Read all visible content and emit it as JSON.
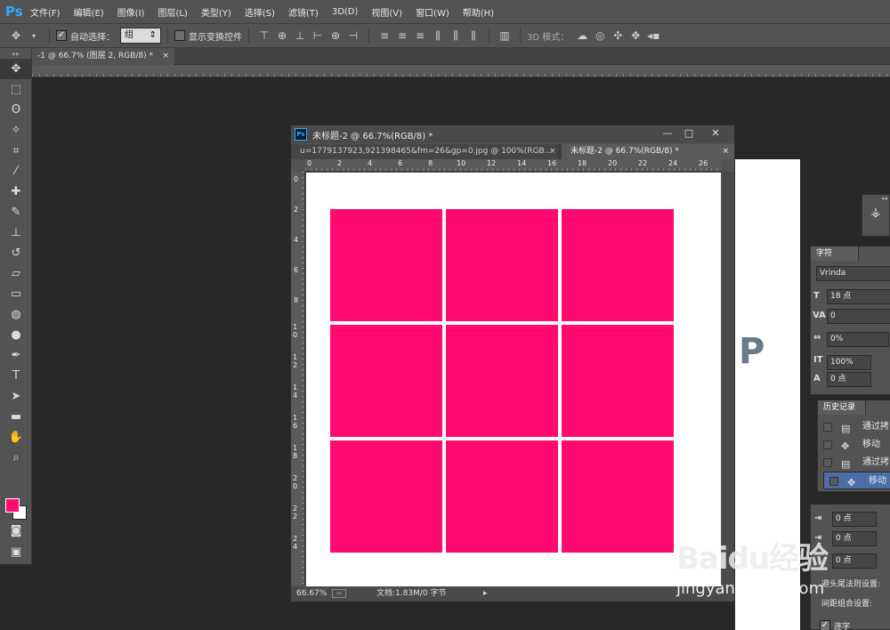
{
  "app": {
    "logo": "Ps"
  },
  "menu": [
    "文件(F)",
    "编辑(E)",
    "图像(I)",
    "图层(L)",
    "类型(Y)",
    "选择(S)",
    "滤镜(T)",
    "3D(D)",
    "视图(V)",
    "窗口(W)",
    "帮助(H)"
  ],
  "options": {
    "auto_select_label": "自动选择：",
    "auto_select_value": "组",
    "show_transform_label": "显示变换控件",
    "mode_3d_label": "3D 模式："
  },
  "main_tab": {
    "title": "-1 @ 66.7% (图层 2, RGB/8) *",
    "close": "×"
  },
  "doc_window": {
    "logo": "Ps",
    "title": "未标题-2 @ 66.7%(RGB/8) *",
    "btn_min": "—",
    "btn_max": "□",
    "btn_close": "✕",
    "tab1": "u=1779137923,921398465&fm=26&gp=0.jpg @ 100%(RGB...",
    "tab2": "未标题-2 @ 66.7%(RGB/8) *",
    "tab_close": "×",
    "hruler_labels": [
      "0",
      "2",
      "4",
      "6",
      "8",
      "10",
      "12",
      "14",
      "16",
      "18",
      "20",
      "22",
      "24",
      "26"
    ],
    "vruler_labels": [
      "0",
      "2",
      "4",
      "6",
      "8",
      "1 0",
      "1 2",
      "1 4",
      "1 6",
      "1 8",
      "2 0",
      "2 2",
      "2 4"
    ],
    "status_zoom": "66.67%",
    "status_doc": "文档:1.83M/0 字节",
    "fill_color": "#ff0a6e"
  },
  "char_panel": {
    "tab": "字符",
    "font": "Vrinda",
    "size": "18 点",
    "kerning": "0",
    "tracking": "0%",
    "scale": "100%",
    "baseline": "0 点"
  },
  "history_panel": {
    "tab": "历史记录",
    "items": [
      {
        "icon": "document-icon",
        "label": "通过拷"
      },
      {
        "icon": "move-icon",
        "label": "移动"
      },
      {
        "icon": "document-icon",
        "label": "通过拷"
      },
      {
        "icon": "move-icon",
        "label": "移动"
      }
    ]
  },
  "para_panel": {
    "indent1": "0 点",
    "indent2": "0 点",
    "indent3": "0 点",
    "rule1": "避头尾法则设置:",
    "rule2": "间距组合设置:",
    "hyphen": "连字"
  },
  "watermark": {
    "logo": "Baidu经验",
    "url": "jingyan.baidu.com"
  }
}
